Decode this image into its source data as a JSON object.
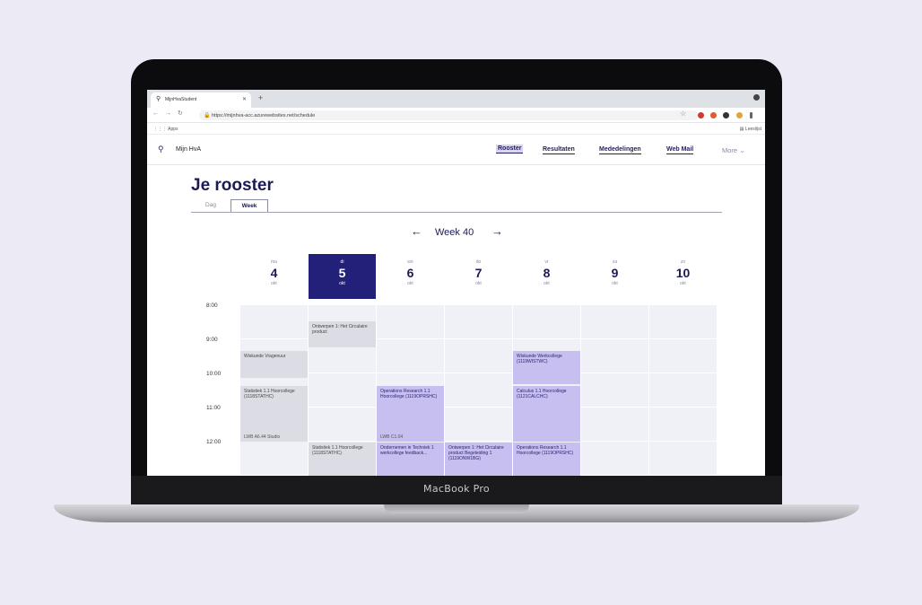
{
  "browser": {
    "tab_title": "MijnHvaStudent",
    "url": "https://mijnhva-acc.azurewebsites.net/schedule",
    "apps_label": "Apps",
    "reading_list": "Leeslijst"
  },
  "site": {
    "logo": "Mijn HvA",
    "nav": [
      "Rooster",
      "Resultaten",
      "Mededelingen",
      "Web Mail"
    ],
    "more": "More"
  },
  "page": {
    "title": "Je rooster",
    "view_tabs": [
      "Dag",
      "Week"
    ],
    "week_label": "Week 40"
  },
  "days": [
    {
      "wd": "ma",
      "num": "4",
      "mon": "okt"
    },
    {
      "wd": "di",
      "num": "5",
      "mon": "okt"
    },
    {
      "wd": "wo",
      "num": "6",
      "mon": "okt"
    },
    {
      "wd": "do",
      "num": "7",
      "mon": "okt"
    },
    {
      "wd": "vr",
      "num": "8",
      "mon": "okt"
    },
    {
      "wd": "za",
      "num": "9",
      "mon": "okt"
    },
    {
      "wd": "zo",
      "num": "10",
      "mon": "okt"
    }
  ],
  "times": [
    "8:00",
    "9:00",
    "10:00",
    "11:00",
    "12:00"
  ],
  "events": {
    "tue_ontwerpen": "Ontwerpen 1: Het Circulaire product",
    "mon_wiskunde": "Wiskunde Vragenuur",
    "mon_statistiek": "Statistiek 1.1 Hoorcollege (1118STATHC)",
    "mon_statistiek_room": "LWB A6.44 Studio",
    "wed_operations": "Operations Research 1.1 Hoorcollege (1119OPRSHC)",
    "wed_operations_room": "LWB C1.04",
    "fri_wiskunde": "Wiskunde Werkcollege (1119WISTWC)",
    "fri_calculus": "Calculus 1.1 Hoorcollege (1121CALCHC)",
    "tue_statistiek": "Statistiek 1.1 Hoorcollege (1118STATHC)",
    "wed_ondernemen": "Ondernemen in Techniek 1 werkcollege feedback...",
    "thu_ontwerpen": "Ontwerpen 1: Het Circulaire product Begeleiding 1 (1119ONW1BG)",
    "fri_operations": "Operations Research 1.1 Hoorcollege (1119OPRSHC)"
  },
  "laptop_label": "MacBook Pro",
  "colors": {
    "today": "#232079",
    "event_purple": "#c7bff0",
    "event_grey": "#dcdce4",
    "nav_active": "#d8d4f2"
  }
}
